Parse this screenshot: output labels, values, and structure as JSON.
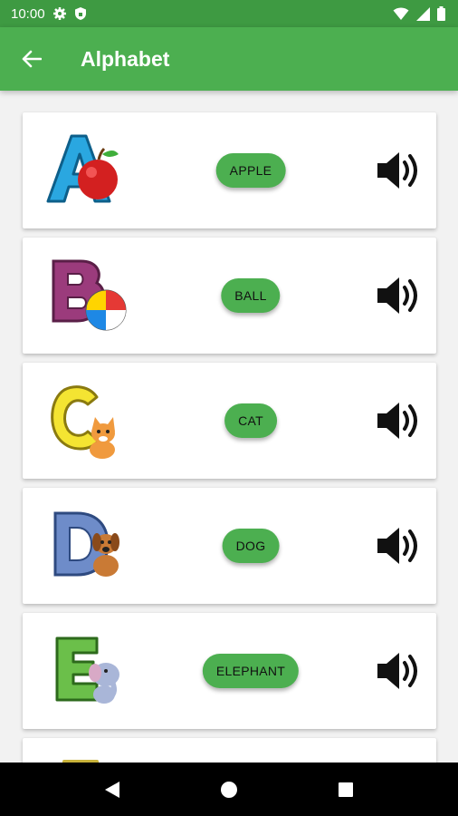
{
  "status_bar": {
    "time": "10:00"
  },
  "app_bar": {
    "title": "Alphabet"
  },
  "items": [
    {
      "letter": "A",
      "word": "APPLE",
      "letter_color": "#2aa7e0",
      "object_icon": "apple-icon"
    },
    {
      "letter": "B",
      "word": "BALL",
      "letter_color": "#9b3b7c",
      "object_icon": "ball-icon"
    },
    {
      "letter": "C",
      "word": "CAT",
      "letter_color": "#f4e432",
      "object_icon": "cat-icon"
    },
    {
      "letter": "D",
      "word": "DOG",
      "letter_color": "#6e8cc9",
      "object_icon": "dog-icon"
    },
    {
      "letter": "E",
      "word": "ELEPHANT",
      "letter_color": "#6bbf4a",
      "object_icon": "elephant-icon"
    }
  ],
  "colors": {
    "app_bar": "#4caf50",
    "status_bar": "#3e9a42",
    "button": "#4caf50"
  }
}
